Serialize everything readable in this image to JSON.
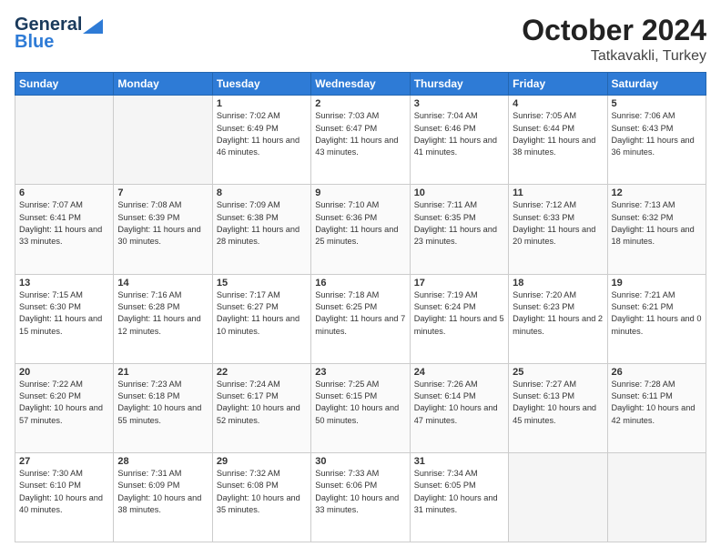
{
  "header": {
    "logo_general": "General",
    "logo_blue": "Blue",
    "month": "October 2024",
    "location": "Tatkavakli, Turkey"
  },
  "days_of_week": [
    "Sunday",
    "Monday",
    "Tuesday",
    "Wednesday",
    "Thursday",
    "Friday",
    "Saturday"
  ],
  "weeks": [
    [
      {
        "day": "",
        "sunrise": "",
        "sunset": "",
        "daylight": ""
      },
      {
        "day": "",
        "sunrise": "",
        "sunset": "",
        "daylight": ""
      },
      {
        "day": "1",
        "sunrise": "Sunrise: 7:02 AM",
        "sunset": "Sunset: 6:49 PM",
        "daylight": "Daylight: 11 hours and 46 minutes."
      },
      {
        "day": "2",
        "sunrise": "Sunrise: 7:03 AM",
        "sunset": "Sunset: 6:47 PM",
        "daylight": "Daylight: 11 hours and 43 minutes."
      },
      {
        "day": "3",
        "sunrise": "Sunrise: 7:04 AM",
        "sunset": "Sunset: 6:46 PM",
        "daylight": "Daylight: 11 hours and 41 minutes."
      },
      {
        "day": "4",
        "sunrise": "Sunrise: 7:05 AM",
        "sunset": "Sunset: 6:44 PM",
        "daylight": "Daylight: 11 hours and 38 minutes."
      },
      {
        "day": "5",
        "sunrise": "Sunrise: 7:06 AM",
        "sunset": "Sunset: 6:43 PM",
        "daylight": "Daylight: 11 hours and 36 minutes."
      }
    ],
    [
      {
        "day": "6",
        "sunrise": "Sunrise: 7:07 AM",
        "sunset": "Sunset: 6:41 PM",
        "daylight": "Daylight: 11 hours and 33 minutes."
      },
      {
        "day": "7",
        "sunrise": "Sunrise: 7:08 AM",
        "sunset": "Sunset: 6:39 PM",
        "daylight": "Daylight: 11 hours and 30 minutes."
      },
      {
        "day": "8",
        "sunrise": "Sunrise: 7:09 AM",
        "sunset": "Sunset: 6:38 PM",
        "daylight": "Daylight: 11 hours and 28 minutes."
      },
      {
        "day": "9",
        "sunrise": "Sunrise: 7:10 AM",
        "sunset": "Sunset: 6:36 PM",
        "daylight": "Daylight: 11 hours and 25 minutes."
      },
      {
        "day": "10",
        "sunrise": "Sunrise: 7:11 AM",
        "sunset": "Sunset: 6:35 PM",
        "daylight": "Daylight: 11 hours and 23 minutes."
      },
      {
        "day": "11",
        "sunrise": "Sunrise: 7:12 AM",
        "sunset": "Sunset: 6:33 PM",
        "daylight": "Daylight: 11 hours and 20 minutes."
      },
      {
        "day": "12",
        "sunrise": "Sunrise: 7:13 AM",
        "sunset": "Sunset: 6:32 PM",
        "daylight": "Daylight: 11 hours and 18 minutes."
      }
    ],
    [
      {
        "day": "13",
        "sunrise": "Sunrise: 7:15 AM",
        "sunset": "Sunset: 6:30 PM",
        "daylight": "Daylight: 11 hours and 15 minutes."
      },
      {
        "day": "14",
        "sunrise": "Sunrise: 7:16 AM",
        "sunset": "Sunset: 6:28 PM",
        "daylight": "Daylight: 11 hours and 12 minutes."
      },
      {
        "day": "15",
        "sunrise": "Sunrise: 7:17 AM",
        "sunset": "Sunset: 6:27 PM",
        "daylight": "Daylight: 11 hours and 10 minutes."
      },
      {
        "day": "16",
        "sunrise": "Sunrise: 7:18 AM",
        "sunset": "Sunset: 6:25 PM",
        "daylight": "Daylight: 11 hours and 7 minutes."
      },
      {
        "day": "17",
        "sunrise": "Sunrise: 7:19 AM",
        "sunset": "Sunset: 6:24 PM",
        "daylight": "Daylight: 11 hours and 5 minutes."
      },
      {
        "day": "18",
        "sunrise": "Sunrise: 7:20 AM",
        "sunset": "Sunset: 6:23 PM",
        "daylight": "Daylight: 11 hours and 2 minutes."
      },
      {
        "day": "19",
        "sunrise": "Sunrise: 7:21 AM",
        "sunset": "Sunset: 6:21 PM",
        "daylight": "Daylight: 11 hours and 0 minutes."
      }
    ],
    [
      {
        "day": "20",
        "sunrise": "Sunrise: 7:22 AM",
        "sunset": "Sunset: 6:20 PM",
        "daylight": "Daylight: 10 hours and 57 minutes."
      },
      {
        "day": "21",
        "sunrise": "Sunrise: 7:23 AM",
        "sunset": "Sunset: 6:18 PM",
        "daylight": "Daylight: 10 hours and 55 minutes."
      },
      {
        "day": "22",
        "sunrise": "Sunrise: 7:24 AM",
        "sunset": "Sunset: 6:17 PM",
        "daylight": "Daylight: 10 hours and 52 minutes."
      },
      {
        "day": "23",
        "sunrise": "Sunrise: 7:25 AM",
        "sunset": "Sunset: 6:15 PM",
        "daylight": "Daylight: 10 hours and 50 minutes."
      },
      {
        "day": "24",
        "sunrise": "Sunrise: 7:26 AM",
        "sunset": "Sunset: 6:14 PM",
        "daylight": "Daylight: 10 hours and 47 minutes."
      },
      {
        "day": "25",
        "sunrise": "Sunrise: 7:27 AM",
        "sunset": "Sunset: 6:13 PM",
        "daylight": "Daylight: 10 hours and 45 minutes."
      },
      {
        "day": "26",
        "sunrise": "Sunrise: 7:28 AM",
        "sunset": "Sunset: 6:11 PM",
        "daylight": "Daylight: 10 hours and 42 minutes."
      }
    ],
    [
      {
        "day": "27",
        "sunrise": "Sunrise: 7:30 AM",
        "sunset": "Sunset: 6:10 PM",
        "daylight": "Daylight: 10 hours and 40 minutes."
      },
      {
        "day": "28",
        "sunrise": "Sunrise: 7:31 AM",
        "sunset": "Sunset: 6:09 PM",
        "daylight": "Daylight: 10 hours and 38 minutes."
      },
      {
        "day": "29",
        "sunrise": "Sunrise: 7:32 AM",
        "sunset": "Sunset: 6:08 PM",
        "daylight": "Daylight: 10 hours and 35 minutes."
      },
      {
        "day": "30",
        "sunrise": "Sunrise: 7:33 AM",
        "sunset": "Sunset: 6:06 PM",
        "daylight": "Daylight: 10 hours and 33 minutes."
      },
      {
        "day": "31",
        "sunrise": "Sunrise: 7:34 AM",
        "sunset": "Sunset: 6:05 PM",
        "daylight": "Daylight: 10 hours and 31 minutes."
      },
      {
        "day": "",
        "sunrise": "",
        "sunset": "",
        "daylight": ""
      },
      {
        "day": "",
        "sunrise": "",
        "sunset": "",
        "daylight": ""
      }
    ]
  ]
}
